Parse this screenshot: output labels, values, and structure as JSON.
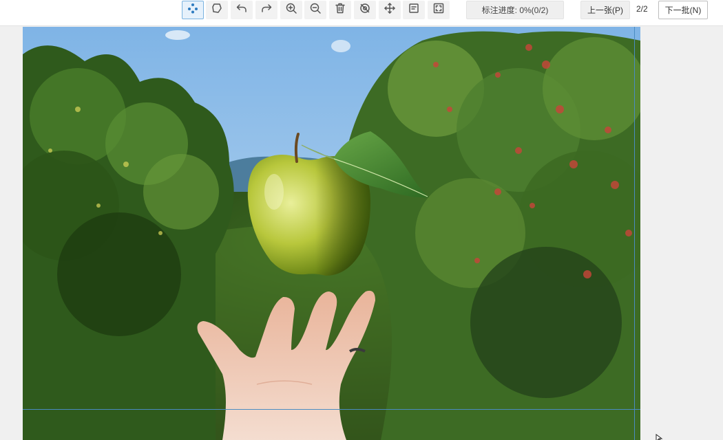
{
  "toolbar": {
    "tools": [
      {
        "name": "points-tool",
        "icon": "points-icon",
        "active": true
      },
      {
        "name": "polygon-tool",
        "icon": "polygon-icon",
        "active": false
      },
      {
        "name": "undo-tool",
        "icon": "undo-icon",
        "active": false
      },
      {
        "name": "redo-tool",
        "icon": "redo-icon",
        "active": false
      },
      {
        "name": "zoom-in-tool",
        "icon": "zoom-in-icon",
        "active": false
      },
      {
        "name": "zoom-out-tool",
        "icon": "zoom-out-icon",
        "active": false
      },
      {
        "name": "delete-tool",
        "icon": "trash-icon",
        "active": false
      },
      {
        "name": "hide-tool",
        "icon": "eye-off-icon",
        "active": false
      },
      {
        "name": "move-tool",
        "icon": "move-icon",
        "active": false
      },
      {
        "name": "fit-tool",
        "icon": "fit-icon",
        "active": false
      },
      {
        "name": "fullscreen-tool",
        "icon": "fullscreen-icon",
        "active": false
      }
    ],
    "progress_label": "标注进度: 0%(0/2)",
    "prev_label": "上一张(P)",
    "page_count": "2/2",
    "next_label": "下一批(N)"
  },
  "image": {
    "subject": "apple-over-hand-photo"
  },
  "colors": {
    "accent": "#2f7cc0",
    "guide_line": "#4a8cc2"
  }
}
